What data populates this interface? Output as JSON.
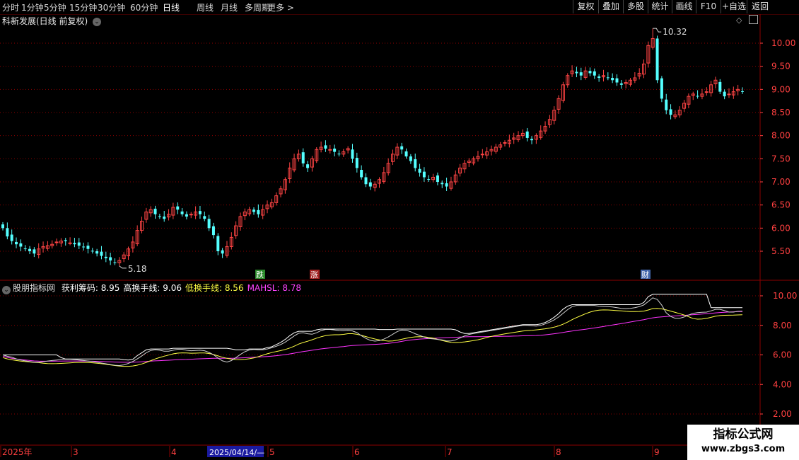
{
  "toolbar": {
    "timeframes": [
      "分时",
      "1分钟",
      "5分钟",
      "15分钟",
      "30分钟",
      "60分钟",
      "日线",
      "周线",
      "月线",
      "多周期",
      "更多 >"
    ],
    "active_timeframe": "日线",
    "buttons": [
      "复权",
      "叠加",
      "多股",
      "统计",
      "画线",
      "F10",
      "+自选",
      "返回"
    ]
  },
  "main_chart": {
    "title": "科新发展(日线 前复权)",
    "high_label": "10.32",
    "low_label": "5.18",
    "y_ticks": [
      "10.00",
      "9.50",
      "9.00",
      "8.50",
      "8.00",
      "7.50",
      "7.00",
      "6.50",
      "6.00",
      "5.50"
    ],
    "events": [
      {
        "text": "跌",
        "color": "#2a8a2a"
      },
      {
        "text": "涨",
        "color": "#a02020"
      },
      {
        "text": "财",
        "color": "#4466aa"
      }
    ]
  },
  "indicator": {
    "name": "股朋指标网",
    "items": [
      {
        "label": "获利筹码: 8.95",
        "color": "#ffffff"
      },
      {
        "label": "高换手线: 9.06",
        "color": "#ffffff"
      },
      {
        "label": "低换手线: 8.56",
        "color": "#ffff44"
      },
      {
        "label": "MAHSL: 8.78",
        "color": "#ff44ff"
      }
    ],
    "y_ticks": [
      "10.00",
      "8.00",
      "6.00",
      "4.00",
      "2.00"
    ]
  },
  "date_axis": {
    "labels": [
      "2025年",
      "3",
      "4",
      "5",
      "6",
      "7",
      "8",
      "9"
    ],
    "cursor_date": "2025/04/14/—"
  },
  "watermark": {
    "line1": "指标公式网",
    "line2": "www.zbgs3.com"
  },
  "colors": {
    "up": "#ff4444",
    "down": "#54ffff",
    "grid": "#8b0000",
    "axis_text": "#ff4040"
  },
  "chart_data": {
    "type": "candlestick",
    "price_range": [
      5.18,
      10.32
    ],
    "ylim": [
      5.1,
      10.5
    ],
    "closes": [
      6.0,
      5.82,
      5.72,
      5.65,
      5.6,
      5.55,
      5.5,
      5.45,
      5.55,
      5.6,
      5.62,
      5.65,
      5.7,
      5.72,
      5.72,
      5.68,
      5.65,
      5.62,
      5.6,
      5.55,
      5.5,
      5.45,
      5.4,
      5.35,
      5.3,
      5.25,
      5.3,
      5.42,
      5.55,
      5.7,
      5.95,
      6.15,
      6.35,
      6.4,
      6.3,
      6.25,
      6.2,
      6.3,
      6.45,
      6.4,
      6.3,
      6.25,
      6.3,
      6.35,
      6.3,
      6.2,
      6.0,
      5.85,
      5.5,
      5.45,
      5.6,
      5.8,
      6.05,
      6.25,
      6.35,
      6.4,
      6.35,
      6.3,
      6.4,
      6.5,
      6.55,
      6.7,
      6.85,
      7.05,
      7.3,
      7.5,
      7.6,
      7.4,
      7.3,
      7.5,
      7.7,
      7.75,
      7.72,
      7.7,
      7.65,
      7.6,
      7.65,
      7.72,
      7.5,
      7.3,
      7.1,
      6.95,
      6.9,
      6.95,
      7.05,
      7.2,
      7.4,
      7.6,
      7.75,
      7.7,
      7.55,
      7.45,
      7.3,
      7.2,
      7.1,
      7.05,
      7.1,
      7.0,
      6.95,
      6.9,
      7.0,
      7.15,
      7.3,
      7.4,
      7.45,
      7.5,
      7.55,
      7.6,
      7.65,
      7.7,
      7.75,
      7.8,
      7.85,
      7.9,
      7.95,
      8.0,
      8.05,
      7.95,
      7.9,
      8.0,
      8.1,
      8.2,
      8.35,
      8.55,
      8.8,
      9.1,
      9.3,
      9.4,
      9.35,
      9.3,
      9.4,
      9.35,
      9.3,
      9.25,
      9.3,
      9.25,
      9.2,
      9.15,
      9.1,
      9.15,
      9.2,
      9.25,
      9.35,
      9.55,
      9.95,
      10.1,
      9.2,
      8.8,
      8.55,
      8.45,
      8.45,
      8.55,
      8.7,
      8.85,
      8.9,
      8.85,
      8.9,
      8.95,
      9.1,
      9.2,
      8.95,
      8.85,
      8.9,
      8.95,
      9.0,
      8.95
    ]
  }
}
